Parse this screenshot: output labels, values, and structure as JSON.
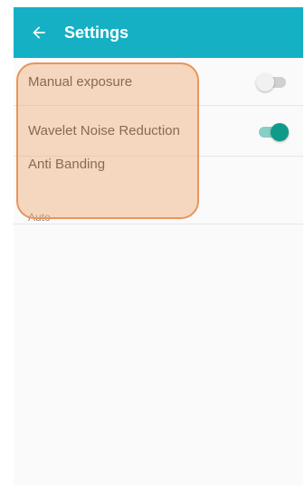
{
  "appbar": {
    "title": "Settings",
    "back_icon": "arrow-left-icon",
    "color": "#16b0c5"
  },
  "settings": [
    {
      "label": "Manual exposure",
      "toggle": "off"
    },
    {
      "label": "Wavelet Noise Reduction",
      "toggle": "on"
    },
    {
      "label": "Anti Banding",
      "summary": "Auto"
    }
  ],
  "colors": {
    "toggle_on": "#0f9a8a",
    "highlight_border": "#e8955a"
  }
}
